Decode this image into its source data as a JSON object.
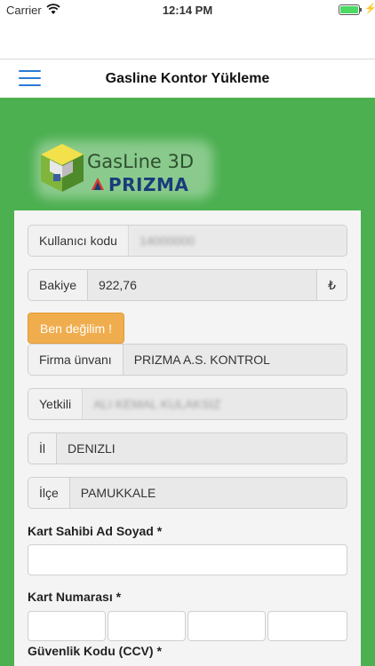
{
  "status_bar": {
    "carrier": "Carrier",
    "time": "12:14 PM"
  },
  "nav": {
    "title": "Gasline Kontor Yükleme"
  },
  "logo": {
    "brand_top": "GasLine 3D",
    "brand_bottom": "PRIZMA"
  },
  "form": {
    "user_code": {
      "label": "Kullanıcı kodu",
      "value": "14000000"
    },
    "balance": {
      "label": "Bakiye",
      "value": "922,76",
      "currency": "₺"
    },
    "not_me_button": "Ben değilim !",
    "company": {
      "label": "Firma ünvanı",
      "value": "PRIZMA A.S. KONTROL"
    },
    "authorized": {
      "label": "Yetkili",
      "value": "ALI KEMAL KULAKSIZ"
    },
    "province": {
      "label": "İl",
      "value": "DENIZLI"
    },
    "district": {
      "label": "İlçe",
      "value": "PAMUKKALE"
    },
    "card_holder": {
      "label": "Kart Sahibi Ad Soyad *",
      "value": ""
    },
    "card_number": {
      "label": "Kart Numarası *",
      "parts": [
        "",
        "",
        "",
        ""
      ]
    },
    "security_code": {
      "label": "Güvenlik Kodu (CCV) *"
    }
  }
}
